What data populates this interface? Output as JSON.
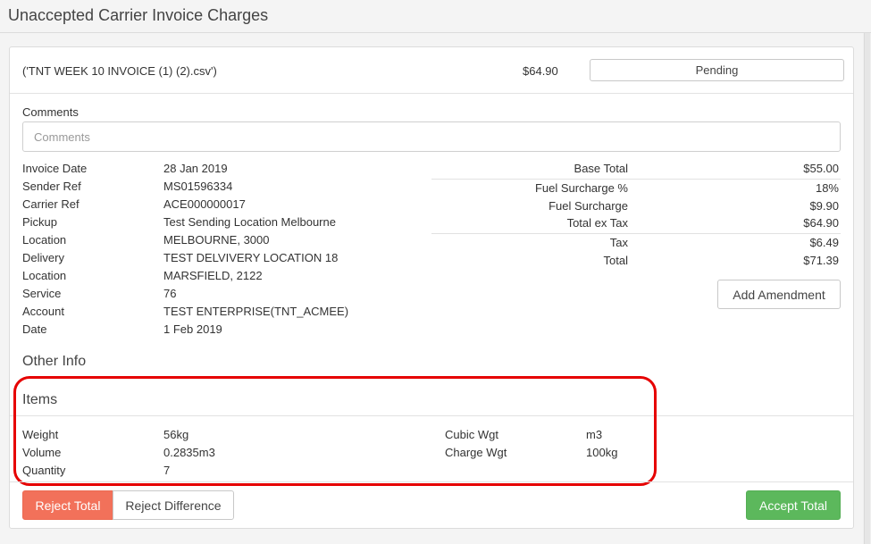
{
  "page": {
    "title": "Unaccepted Carrier Invoice Charges"
  },
  "invoice": {
    "file_name": "('TNT WEEK 10 INVOICE (1) (2).csv')",
    "amount": "$64.90",
    "status_label": "Pending"
  },
  "comments": {
    "label": "Comments",
    "placeholder": "Comments",
    "value": ""
  },
  "details": [
    {
      "label": "Invoice Date",
      "value": "28 Jan 2019"
    },
    {
      "label": "Sender Ref",
      "value": "MS01596334"
    },
    {
      "label": "Carrier Ref",
      "value": "ACE000000017"
    },
    {
      "label": "Pickup",
      "value": "Test Sending Location Melbourne"
    },
    {
      "label": "Location",
      "value": "MELBOURNE, 3000"
    },
    {
      "label": "Delivery",
      "value": "TEST DELVIVERY LOCATION 18"
    },
    {
      "label": "Location",
      "value": "MARSFIELD, 2122"
    },
    {
      "label": "Service",
      "value": "76"
    },
    {
      "label": "Account",
      "value": "TEST ENTERPRISE(TNT_ACMEE)"
    },
    {
      "label": "Date",
      "value": "1 Feb 2019"
    }
  ],
  "totals": [
    {
      "label": "Base Total",
      "value": "$55.00"
    },
    {
      "label": "Fuel Surcharge %",
      "value": "18%"
    },
    {
      "label": "Fuel Surcharge",
      "value": "$9.90"
    },
    {
      "label": "Total ex Tax",
      "value": "$64.90"
    },
    {
      "label": "Tax",
      "value": "$6.49"
    },
    {
      "label": "Total",
      "value": "$71.39"
    }
  ],
  "add_amendment_label": "Add Amendment",
  "other_info": {
    "title": "Other Info"
  },
  "items": {
    "title": "Items",
    "left": [
      {
        "label": "Weight",
        "value": "56kg"
      },
      {
        "label": "Volume",
        "value": "0.2835m3"
      },
      {
        "label": "Quantity",
        "value": "7"
      }
    ],
    "right": [
      {
        "label": "Cubic Wgt",
        "value": "m3"
      },
      {
        "label": "Charge Wgt",
        "value": "100kg"
      }
    ]
  },
  "actions": {
    "reject_total": "Reject Total",
    "reject_difference": "Reject Difference",
    "accept_total": "Accept Total"
  },
  "colors": {
    "reject": "#f2715a",
    "accept": "#5cb85c",
    "highlight": "#e60000"
  }
}
